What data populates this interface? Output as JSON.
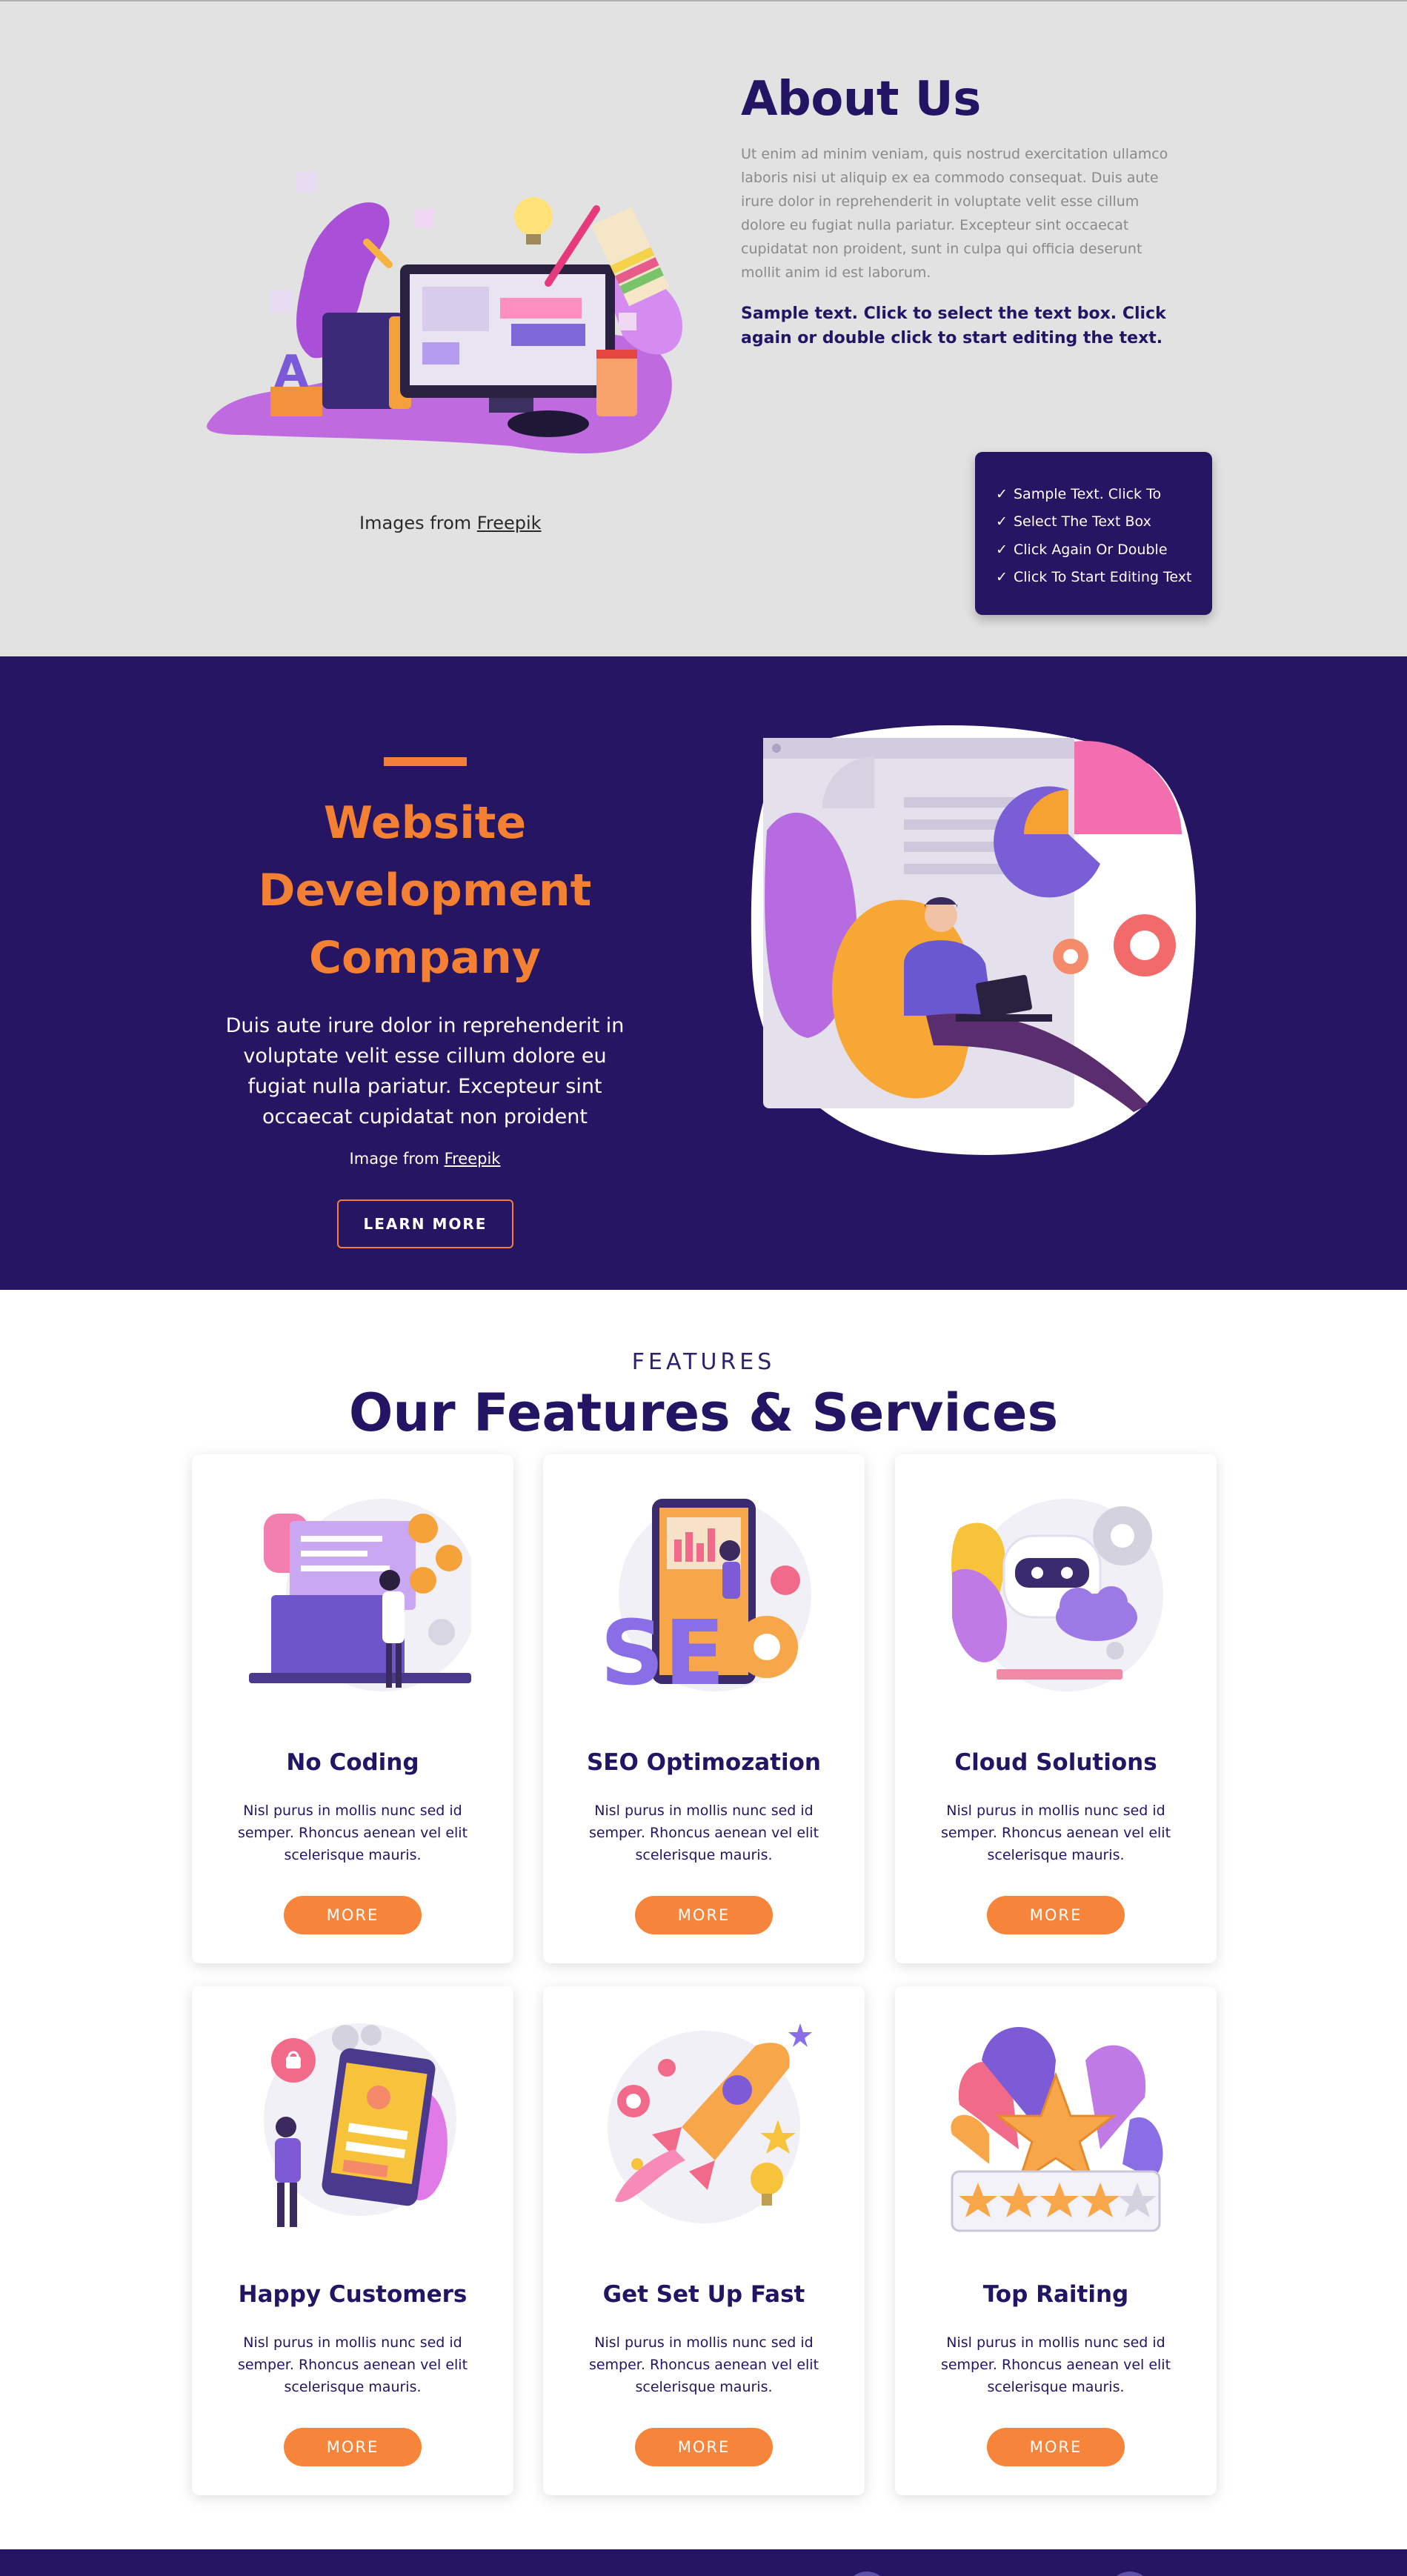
{
  "about": {
    "title": "About Us",
    "paragraph": "Ut enim ad minim veniam, quis nostrud exercitation ullamco laboris nisi ut aliquip ex ea commodo consequat. Duis aute irure dolor in reprehenderit in voluptate velit esse cillum dolore eu fugiat nulla pariatur. Excepteur sint occaecat cupidatat non proident, sunt in culpa qui officia deserunt mollit anim id est laborum.",
    "bold_text": "Sample text. Click to select the text box. Click again or double click to start editing the text.",
    "credit_prefix": "Images from",
    "credit_link": "Freepik",
    "checklist": [
      "Sample Text. Click To",
      "Select The Text Box",
      "Click Again Or Double",
      "Click To Start Editing Text"
    ],
    "illustration_icon": "web-design-illustration-icon"
  },
  "dev": {
    "title": "Website Development Company",
    "paragraph": "Duis aute irure dolor in reprehenderit in voluptate velit esse cillum dolore eu fugiat nulla pariatur. Excepteur sint occaecat cupidatat non proident",
    "credit_prefix": "Image from",
    "credit_link": "Freepik",
    "button": "LEARN MORE",
    "illustration_icon": "developer-dashboard-illustration-icon"
  },
  "features": {
    "kicker": "FEATURES",
    "title": "Our Features & Services",
    "cards": [
      {
        "title": "No Coding",
        "text": "Nisl purus in mollis nunc sed id semper. Rhoncus aenean vel elit scelerisque mauris.",
        "button": "MORE",
        "icon": "coding-illustration-icon"
      },
      {
        "title": "SEO Optimozation",
        "text": "Nisl purus in mollis nunc sed id semper. Rhoncus aenean vel elit scelerisque mauris.",
        "button": "MORE",
        "icon": "seo-illustration-icon"
      },
      {
        "title": "Cloud Solutions",
        "text": "Nisl purus in mollis nunc sed id semper. Rhoncus aenean vel elit scelerisque mauris.",
        "button": "MORE",
        "icon": "cloud-robot-illustration-icon"
      },
      {
        "title": "Happy Customers",
        "text": "Nisl purus in mollis nunc sed id semper. Rhoncus aenean vel elit scelerisque mauris.",
        "button": "MORE",
        "icon": "customer-profile-illustration-icon"
      },
      {
        "title": "Get Set Up Fast",
        "text": "Nisl purus in mollis nunc sed id semper. Rhoncus aenean vel elit scelerisque mauris.",
        "button": "MORE",
        "icon": "rocket-illustration-icon"
      },
      {
        "title": "Top Raiting",
        "text": "Nisl purus in mollis nunc sed id semper. Rhoncus aenean vel elit scelerisque mauris.",
        "button": "MORE",
        "icon": "star-rating-illustration-icon"
      }
    ]
  },
  "colors": {
    "navy": "#251563",
    "orange": "#f48133",
    "about_bg": "#e2e2e2"
  }
}
